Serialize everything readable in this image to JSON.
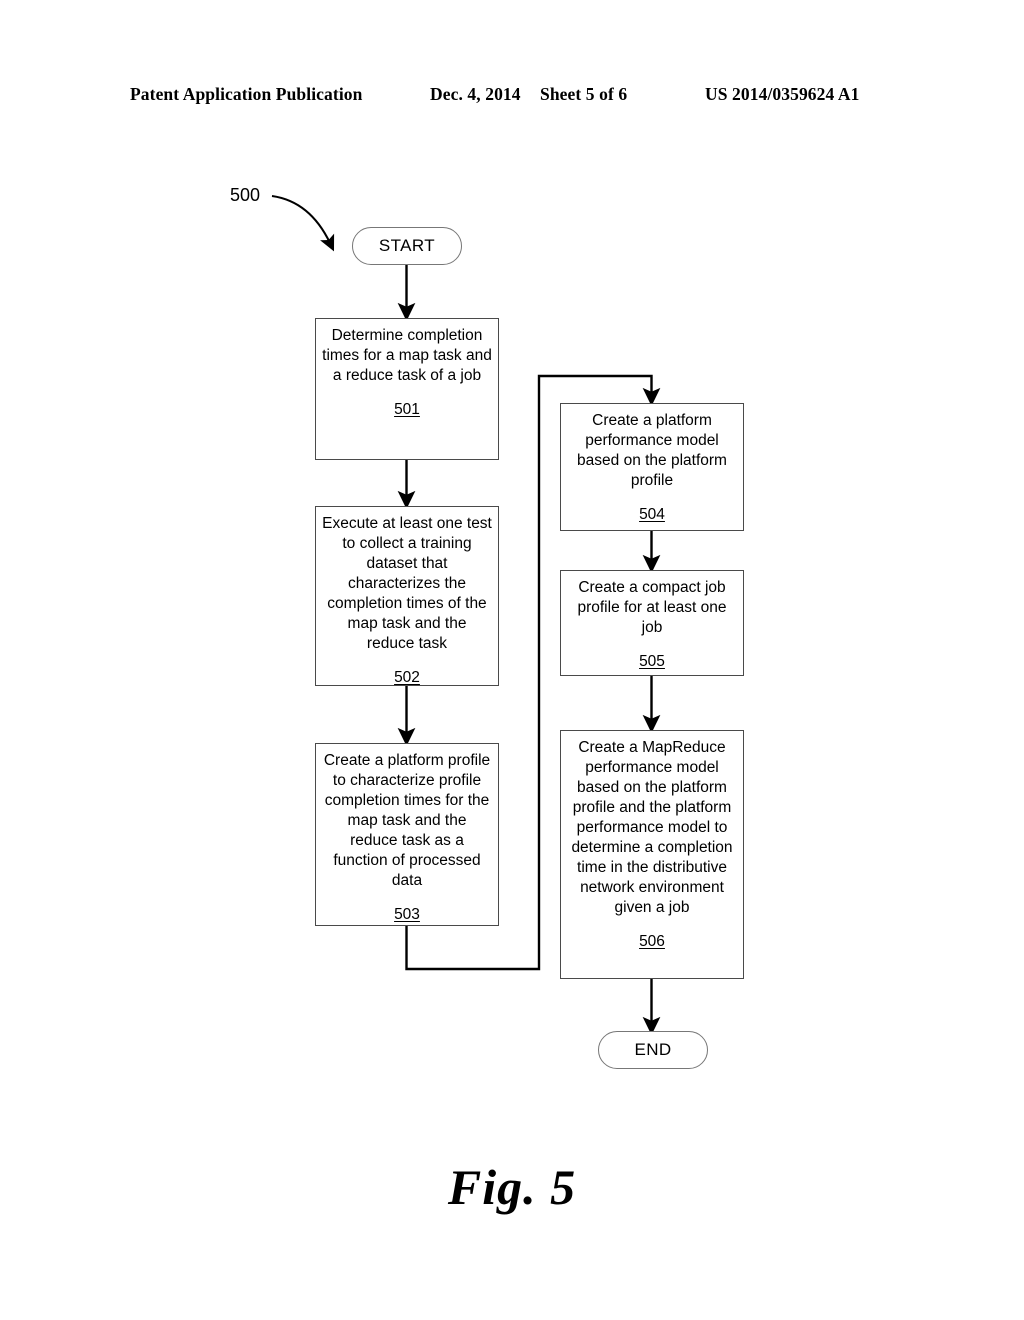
{
  "header": {
    "publication": "Patent Application Publication",
    "date": "Dec. 4, 2014",
    "sheet": "Sheet 5 of 6",
    "patent_number": "US 2014/0359624 A1"
  },
  "figure": {
    "caption": "Fig. 5",
    "reference_numeral": "500",
    "start_label": "START",
    "end_label": "END"
  },
  "flowchart": {
    "nodes": [
      {
        "id": "501",
        "text": "Determine completion times for a map task and a reduce task of a job",
        "number": "501"
      },
      {
        "id": "502",
        "text": "Execute at least one test to collect a training dataset that characterizes the completion times of the map task and the reduce task",
        "number": "502"
      },
      {
        "id": "503",
        "text": "Create a platform profile to characterize profile completion times for the map task and the reduce task as a function of processed data",
        "number": "503"
      },
      {
        "id": "504",
        "text": "Create a platform performance model based on the platform profile",
        "number": "504"
      },
      {
        "id": "505",
        "text": "Create a compact job profile for at least one job",
        "number": "505"
      },
      {
        "id": "506",
        "text": "Create a MapReduce performance model based on the platform profile and the platform performance model to determine a completion time in the distributive network environment given a job",
        "number": "506"
      }
    ]
  }
}
